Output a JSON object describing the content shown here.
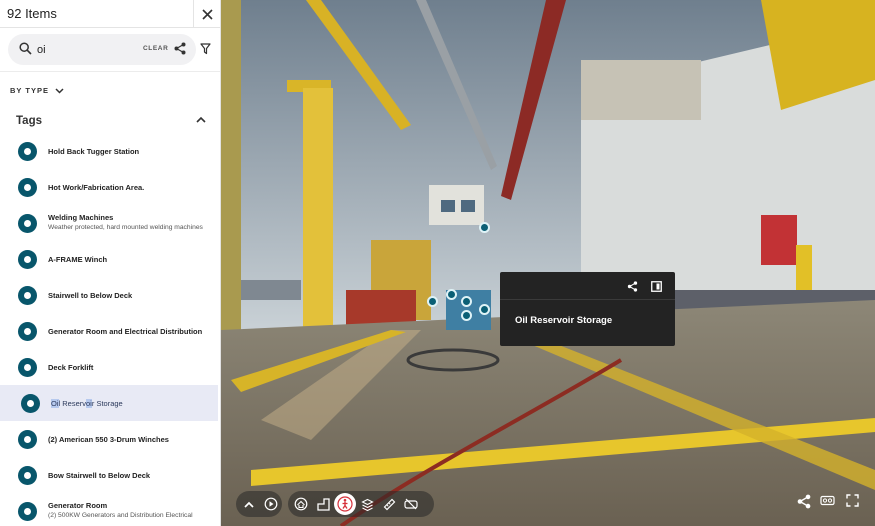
{
  "panel": {
    "title": "92 Items",
    "search": {
      "value": "oi",
      "placeholder": "",
      "clear_label": "CLEAR"
    },
    "group_by_label": "BY TYPE",
    "section_title": "Tags",
    "items": [
      {
        "label": "Hold Back Tugger Station",
        "sub": ""
      },
      {
        "label": "Hot Work/Fabrication Area.",
        "sub": ""
      },
      {
        "label": "Welding Machines",
        "sub": "Weather protected, hard mounted welding machines"
      },
      {
        "label": "A-FRAME Winch",
        "sub": ""
      },
      {
        "label": "Stairwell to Below Deck",
        "sub": ""
      },
      {
        "label": "Generator Room and Electrical Distribution",
        "sub": ""
      },
      {
        "label": "Deck Forklift",
        "sub": ""
      },
      {
        "label": "Oil Reservoir Storage",
        "sub": "",
        "selected": true
      },
      {
        "label": "(2) American 550 3-Drum Winches",
        "sub": ""
      },
      {
        "label": "Bow Stairwell to Below Deck",
        "sub": ""
      },
      {
        "label": "Generator Room",
        "sub": "(2) 500KW Generators and Distribution Electrical"
      }
    ]
  },
  "tooltip": {
    "title": "Oil Reservoir Storage"
  },
  "icons": {
    "close": "close-icon",
    "search": "search-icon",
    "share": "share-icon",
    "filter": "filter-icon",
    "chevron_down": "chevron-down-icon",
    "chevron_up": "chevron-up-icon",
    "toolbar_left": [
      "chevron-up-icon",
      "play-icon"
    ],
    "toolbar_main": [
      "dollhouse-icon",
      "floorplan-icon",
      "walk-person-icon",
      "layers-icon",
      "measure-icon",
      "vr-headset-icon"
    ],
    "toolbar_right": [
      "share-icon",
      "vr-icon",
      "fullscreen-icon"
    ]
  },
  "colors": {
    "tag_dot": "#08566b",
    "selected_row": "#e8eaf5",
    "tooltip_bg": "#232323",
    "highlight": "#b6c9ee"
  }
}
